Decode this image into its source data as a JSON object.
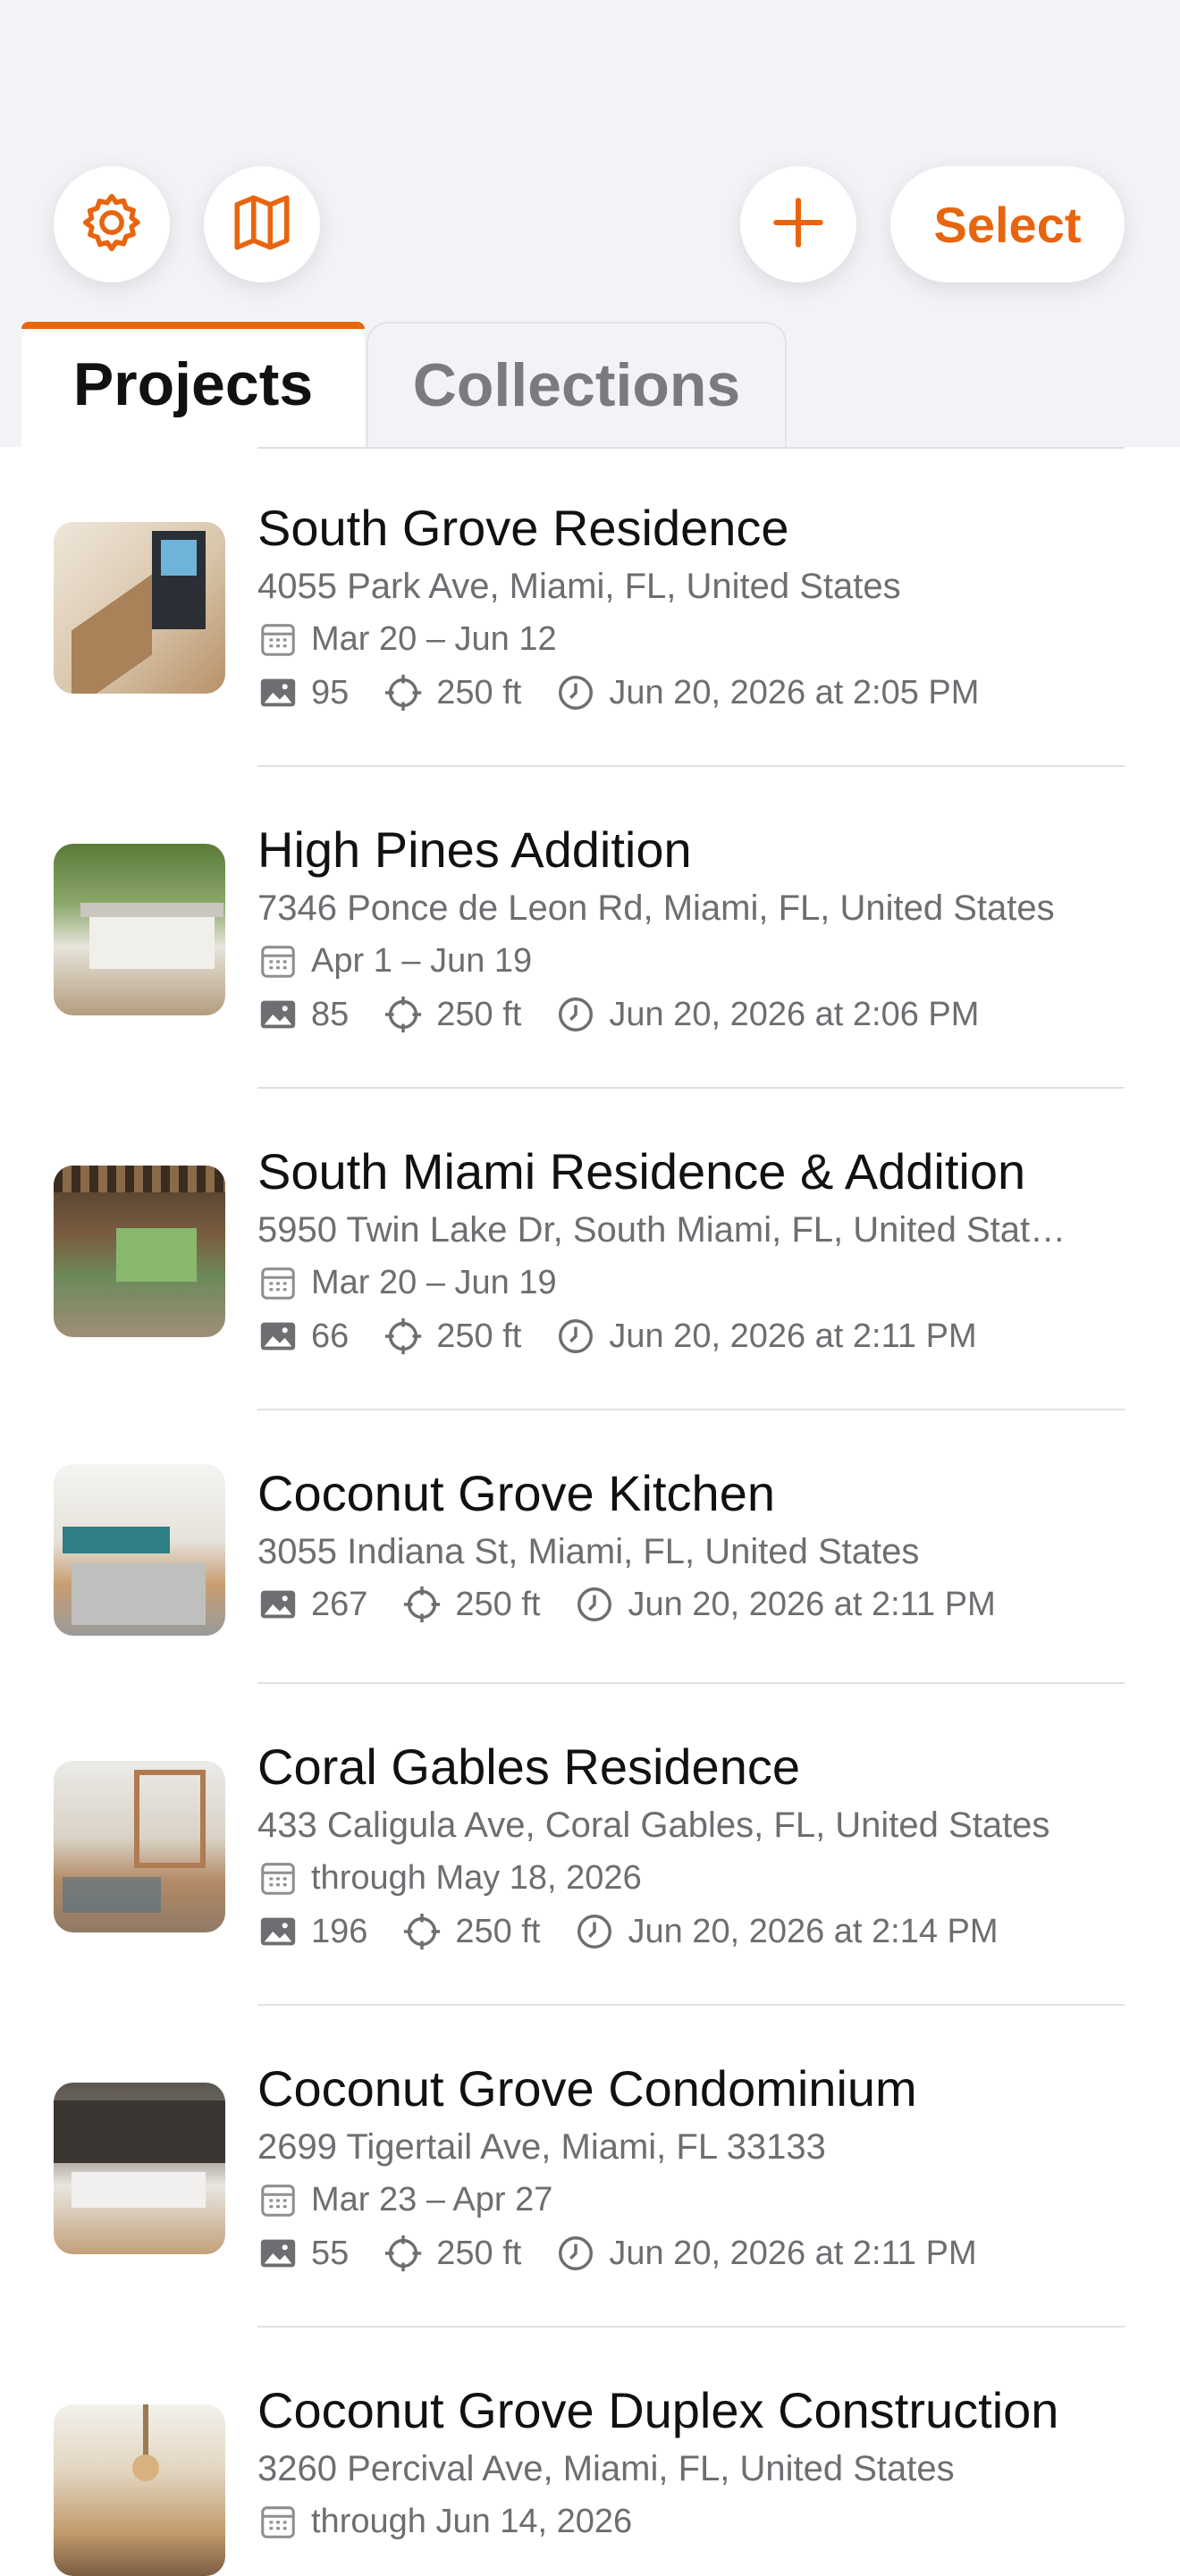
{
  "toolbar": {
    "select_label": "Select",
    "accent_color": "#e8650f"
  },
  "tabs": [
    {
      "label": "Projects",
      "active": true
    },
    {
      "label": "Collections",
      "active": false
    }
  ],
  "projects": [
    {
      "title": "South Grove Residence",
      "address": "4055 Park Ave, Miami, FL, United States",
      "dates": "Mar 20 – Jun 12",
      "photos": "95",
      "distance": "250 ft",
      "updated": "Jun 20, 2026 at 2:05 PM"
    },
    {
      "title": "High Pines Addition",
      "address": "7346 Ponce de Leon Rd, Miami, FL, United States",
      "dates": "Apr 1 – Jun 19",
      "photos": "85",
      "distance": "250 ft",
      "updated": "Jun 20, 2026 at 2:06 PM"
    },
    {
      "title": "South Miami Residence & Addition",
      "address": "5950 Twin Lake Dr, South Miami, FL, United Stat…",
      "dates": "Mar 20 – Jun 19",
      "photos": "66",
      "distance": "250 ft",
      "updated": "Jun 20, 2026 at 2:11 PM"
    },
    {
      "title": "Coconut Grove Kitchen",
      "address": "3055 Indiana St, Miami, FL, United States",
      "photos": "267",
      "distance": "250 ft",
      "updated": "Jun 20, 2026 at 2:11 PM"
    },
    {
      "title": "Coral Gables Residence",
      "address": "433 Caligula Ave, Coral Gables, FL, United States",
      "dates": "through May 18, 2026",
      "photos": "196",
      "distance": "250 ft",
      "updated": "Jun 20, 2026 at 2:14 PM"
    },
    {
      "title": "Coconut Grove Condominium",
      "address": "2699 Tigertail Ave, Miami, FL 33133",
      "dates": "Mar 23 – Apr 27",
      "photos": "55",
      "distance": "250 ft",
      "updated": "Jun 20, 2026 at 2:11 PM"
    },
    {
      "title": "Coconut Grove Duplex Construction",
      "address": "3260 Percival Ave, Miami, FL, United States",
      "dates": "through Jun 14, 2026"
    }
  ]
}
